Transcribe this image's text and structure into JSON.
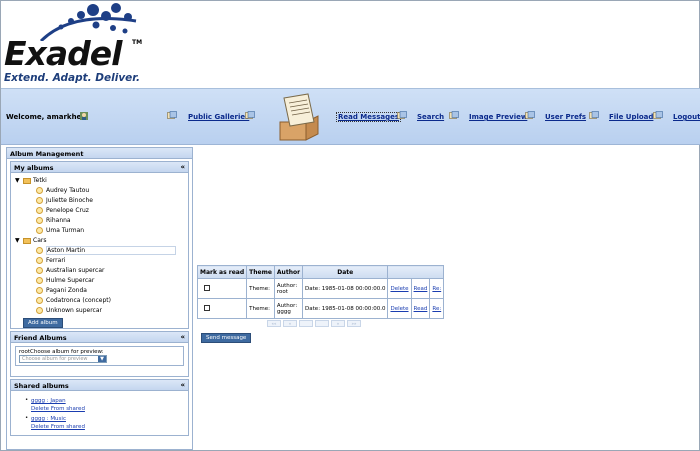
{
  "header": {
    "logo_word": "Exadel",
    "logo_tm": "TM",
    "tagline": "Extend. Adapt. Deliver."
  },
  "topbar": {
    "welcome": "Welcome, amarkhel!",
    "nav": [
      {
        "label": "Public Galleries",
        "active": false
      },
      {
        "label": "Read Messages",
        "active": true
      },
      {
        "label": "Search",
        "active": false
      },
      {
        "label": "Image Preview",
        "active": false
      },
      {
        "label": "User Prefs",
        "active": false
      },
      {
        "label": "File Upload",
        "active": false
      },
      {
        "label": "Logout",
        "active": false
      }
    ]
  },
  "left": {
    "title": "Album Management",
    "my_albums": {
      "title": "My albums",
      "collapse": "«",
      "groups": [
        {
          "name": "Tetki",
          "items": [
            "Audrey Tautou",
            "Juliette Binoche",
            "Penelope Cruz",
            "Rihanna",
            "Uma Turman"
          ]
        },
        {
          "name": "Cars",
          "items": [
            "Aston Martin",
            "Ferrari",
            "Australian supercar",
            "Hulme Supercar",
            "Pagani Zonda",
            "Codatronca (concept)",
            "Unknown supercar"
          ]
        }
      ],
      "add_button": "Add album"
    },
    "friend_albums": {
      "title": "Friend Albums",
      "collapse": "«",
      "label": "rootChoose album for preview:",
      "select_placeholder": "Choose album for preview"
    },
    "shared_albums": {
      "title": "Shared albums",
      "collapse": "«",
      "items": [
        {
          "name": "gggg : Japan",
          "action": "Delete From shared"
        },
        {
          "name": "gggg : Music",
          "action": "Delete From shared"
        }
      ]
    }
  },
  "messages": {
    "headers": [
      "Mark as read",
      "Theme",
      "Author",
      "Date"
    ],
    "rows": [
      {
        "theme": "Theme:",
        "author_label": "Author:",
        "author": "root",
        "date": "Date: 1985-01-08 00:00:00.0",
        "delete": "Delete",
        "read": "Read",
        "reply": "Re:"
      },
      {
        "theme": "Theme:",
        "author_label": "Author:",
        "author": "gggg",
        "date": "Date: 1985-01-08 00:00:00.0",
        "delete": "Delete",
        "read": "Read",
        "reply": "Re:"
      }
    ],
    "pager": [
      "««",
      "«",
      "",
      "",
      "»",
      "»»"
    ],
    "send_button": "Send message"
  },
  "colors": {
    "topbar": "#c4d8f3",
    "button": "#3e6aa0",
    "link": "#1a3db0",
    "logo_blue": "#1d3d7a"
  }
}
